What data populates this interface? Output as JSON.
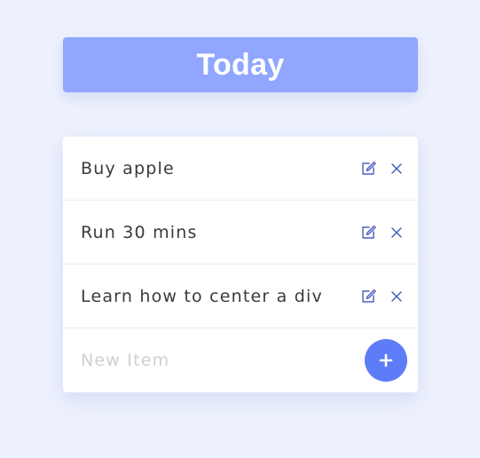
{
  "header": {
    "title": "Today"
  },
  "todo": {
    "items": [
      {
        "label": "Buy apple",
        "edit_icon": "edit-icon",
        "delete_icon": "close-icon"
      },
      {
        "label": "Run 30 mins",
        "edit_icon": "edit-icon",
        "delete_icon": "close-icon"
      },
      {
        "label": "Learn how to center a div",
        "edit_icon": "edit-icon",
        "delete_icon": "close-icon"
      }
    ],
    "new_item": {
      "placeholder": "New Item",
      "value": "",
      "add_icon": "plus-icon"
    }
  },
  "colors": {
    "page_background": "#edf1fd",
    "header_background": "#90a6ff",
    "accent": "#5f7cf8",
    "icon": "#4c5fc0",
    "text": "#3a3a3a",
    "placeholder": "#cfcfd4"
  }
}
